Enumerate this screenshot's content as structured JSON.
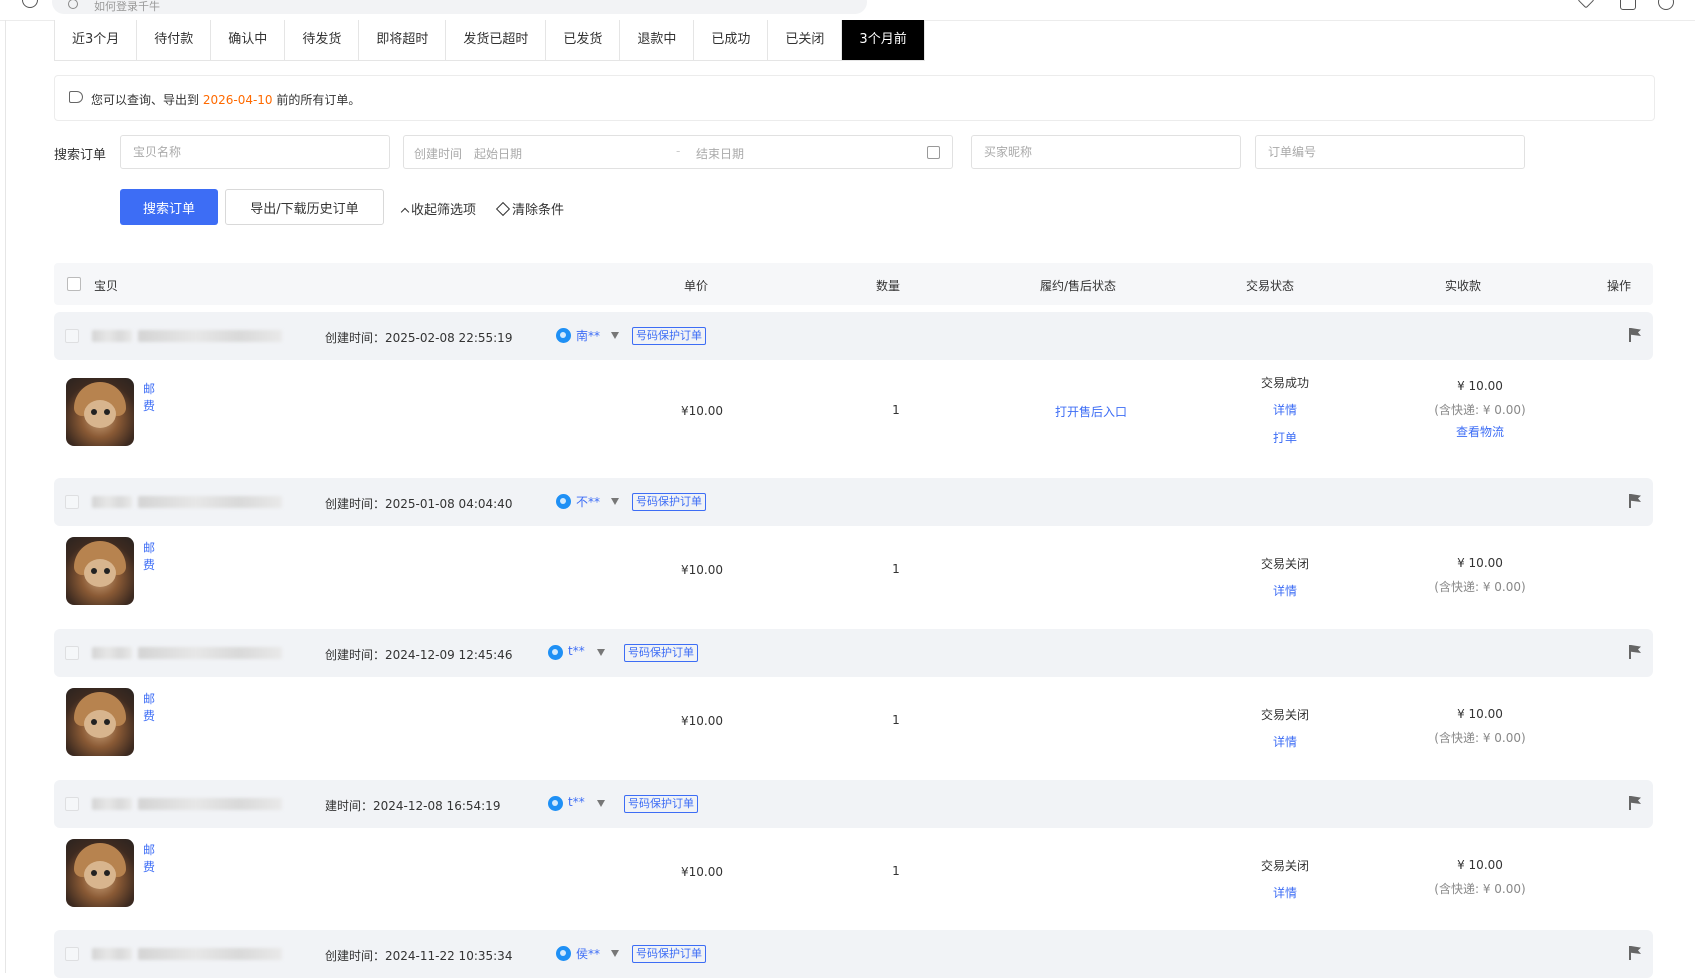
{
  "browser": {
    "address_text": "如何登录千牛"
  },
  "tabs": [
    "近3个月",
    "待付款",
    "确认中",
    "待发货",
    "即将超时",
    "发货已超时",
    "已发货",
    "退款中",
    "已成功",
    "已关闭",
    "3个月前"
  ],
  "active_tab": "3个月前",
  "notice": {
    "prefix": "您可以查询、导出到 ",
    "date": "2026-04-10",
    "suffix": " 前的所有订单。"
  },
  "search": {
    "label": "搜索订单",
    "item_name_placeholder": "宝贝名称",
    "created_time_label": "创建时间",
    "start_date_placeholder": "起始日期",
    "date_separator": "-",
    "end_date_placeholder": "结束日期",
    "buyer_nick_placeholder": "买家昵称",
    "order_no_placeholder": "订单编号",
    "search_button": "搜索订单",
    "export_button": "导出/下载历史订单",
    "collapse_filters": "收起筛选项",
    "clear_conditions": "清除条件"
  },
  "table_headers": {
    "item": "宝贝",
    "price": "单价",
    "quantity": "数量",
    "fulfillment": "履约/售后状态",
    "trade_status": "交易状态",
    "received": "实收款",
    "actions": "操作"
  },
  "orders": [
    {
      "created": "创建时间：2025-02-08 22:55:19",
      "buyer": "南**",
      "badge": "号码保护订单",
      "item_name": "邮费",
      "price": "¥10.00",
      "quantity": "1",
      "fulfillment_link": "打开售后入口",
      "trade_status": "交易成功",
      "detail_link": "详情",
      "print_link": "打单",
      "received": "¥ 10.00",
      "shipping_note": "(含快递: ¥ 0.00)",
      "logistics_link": "查看物流"
    },
    {
      "created": "创建时间：2025-01-08 04:04:40",
      "buyer": "不**",
      "badge": "号码保护订单",
      "item_name": "邮费",
      "price": "¥10.00",
      "quantity": "1",
      "trade_status": "交易关闭",
      "detail_link": "详情",
      "received": "¥ 10.00",
      "shipping_note": "(含快递: ¥ 0.00)"
    },
    {
      "created": "创建时间：2024-12-09 12:45:46",
      "buyer": "t**",
      "badge": "号码保护订单",
      "item_name": "邮费",
      "price": "¥10.00",
      "quantity": "1",
      "trade_status": "交易关闭",
      "detail_link": "详情",
      "received": "¥ 10.00",
      "shipping_note": "(含快递: ¥ 0.00)"
    },
    {
      "created": "建时间：2024-12-08 16:54:19",
      "buyer": "t**",
      "badge": "号码保护订单",
      "item_name": "邮费",
      "price": "¥10.00",
      "quantity": "1",
      "trade_status": "交易关闭",
      "detail_link": "详情",
      "received": "¥ 10.00",
      "shipping_note": "(含快递: ¥ 0.00)"
    },
    {
      "created": "创建时间：2024-11-22 10:35:34",
      "buyer": "侯**",
      "badge": "号码保护订单"
    }
  ],
  "colors": {
    "accent": "#3d6df5",
    "notice_date": "#ff6a00",
    "active_tab_bg": "#000000",
    "buyer_icon": "#1f90f5"
  },
  "icons": [
    "history-icon",
    "search-icon",
    "star-icon",
    "bookmark-icon",
    "clock-icon",
    "bell-icon",
    "calendar-icon",
    "chevron-up-icon",
    "eraser-icon",
    "buyer-avatar-icon",
    "filter-icon",
    "flag-icon"
  ]
}
